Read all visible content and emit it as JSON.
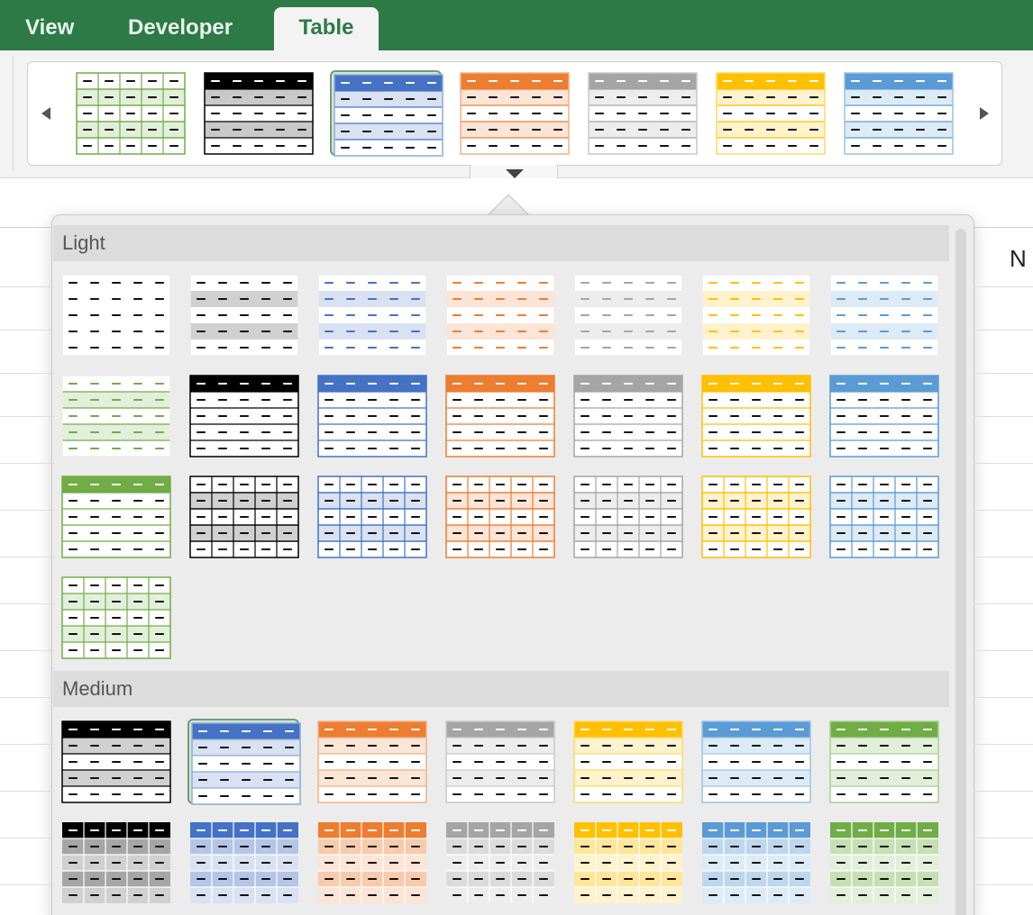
{
  "ribbon": {
    "tabs": [
      {
        "label": "View"
      },
      {
        "label": "Developer"
      },
      {
        "label": "Table",
        "active": true
      }
    ]
  },
  "sheet": {
    "column_header_visible": "N"
  },
  "gallery": {
    "quick_styles": [
      {
        "color": "#70ad47",
        "border": "#70ad47",
        "header": "none",
        "band": "#e2efda",
        "grid": true,
        "header_text": "#000"
      },
      {
        "color": "#000000",
        "border": "#000000",
        "header": "#000000",
        "band": "#c9c9c9",
        "grid": false,
        "header_text": "#fff"
      },
      {
        "color": "#4472c4",
        "border": "#8eaadb",
        "header": "#4472c4",
        "band": "#d9e1f2",
        "grid": false,
        "header_text": "#fff"
      },
      {
        "color": "#ed7d31",
        "border": "#f4b183",
        "header": "#ed7d31",
        "band": "#fce4d6",
        "grid": false,
        "header_text": "#fff"
      },
      {
        "color": "#a5a5a5",
        "border": "#c9c9c9",
        "header": "#a5a5a5",
        "band": "#ededed",
        "grid": false,
        "header_text": "#fff"
      },
      {
        "color": "#ffc000",
        "border": "#ffd966",
        "header": "#ffc000",
        "band": "#fff2cc",
        "grid": false,
        "header_text": "#fff"
      },
      {
        "color": "#5b9bd5",
        "border": "#9bc2e6",
        "header": "#5b9bd5",
        "band": "#ddebf7",
        "grid": false,
        "header_text": "#fff"
      }
    ],
    "selected_index": 2
  },
  "panel": {
    "sections": [
      {
        "title": "Light"
      },
      {
        "title": "Medium"
      }
    ]
  },
  "icons": {
    "scroll_left": "chevron-left-icon",
    "scroll_right": "chevron-right-icon",
    "expand": "chevron-down-icon"
  }
}
